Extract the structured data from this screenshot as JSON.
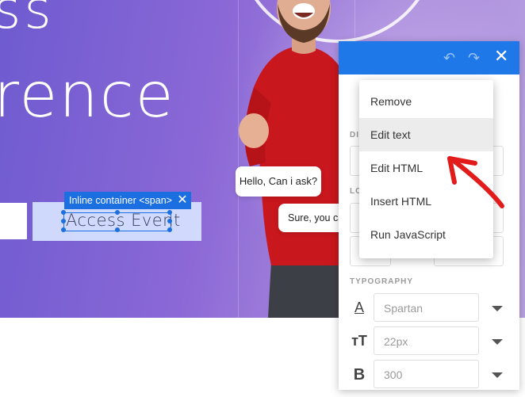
{
  "hero": {
    "line1": "ss",
    "line2": "rence"
  },
  "selection": {
    "tag_label": "Inline container <span>",
    "close_glyph": "✕",
    "text": "Access Event"
  },
  "chat": {
    "bubble1": "Hello, Can i ask?",
    "bubble2": "Sure, you ca"
  },
  "panel": {
    "undo_icon": "↶",
    "redo_icon": "↷",
    "close_icon": "✕",
    "label_di": "DI",
    "label_lo": "LO",
    "typography_label": "TYPOGRAPHY",
    "font_family_icon": "A",
    "font_family": "Spartan",
    "font_size_icon": "тT",
    "font_size": "22px",
    "font_weight_icon": "B",
    "font_weight": "300"
  },
  "menu": {
    "items": [
      {
        "label": "Remove"
      },
      {
        "label": "Edit text"
      },
      {
        "label": "Edit HTML"
      },
      {
        "label": "Insert HTML"
      },
      {
        "label": "Run JavaScript"
      }
    ],
    "active_index": 1
  },
  "colors": {
    "accent": "#1f78e8",
    "arrow": "#e21b1b"
  }
}
